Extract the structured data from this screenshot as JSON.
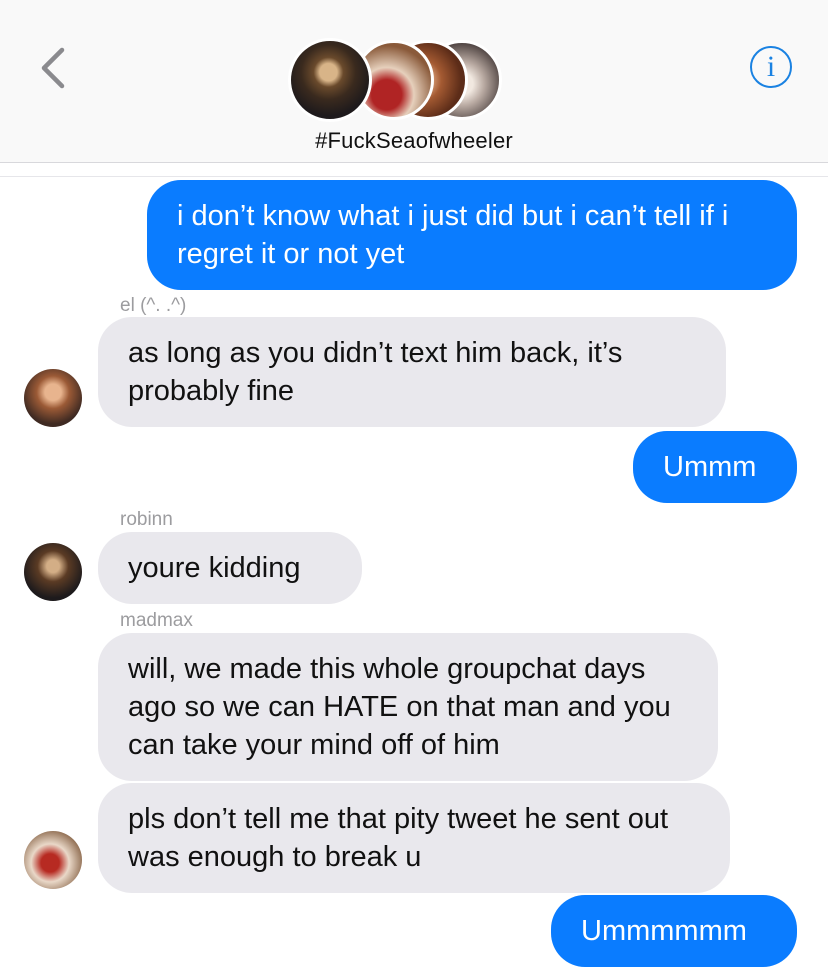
{
  "header": {
    "group_name": "#FuckSeaofwheeler",
    "info_glyph": "i",
    "back_icon": "chevron-left-icon"
  },
  "messages": [
    {
      "direction": "outgoing",
      "text": "i don’t know what i just did but i can’t tell if i regret it or not yet"
    },
    {
      "direction": "incoming",
      "sender": "el (^. .^)",
      "text": "as long as you didn’t text him back, it’s probably fine"
    },
    {
      "direction": "outgoing",
      "text": "Ummm"
    },
    {
      "direction": "incoming",
      "sender": "robinn",
      "text": "youre kidding"
    },
    {
      "direction": "incoming",
      "sender": "madmax",
      "text": "will, we made this whole groupchat days ago so we can HATE on that man and you can take your mind off of him"
    },
    {
      "direction": "incoming",
      "sender": "",
      "text": "pls don’t tell me that pity tweet he sent out was enough to break u"
    },
    {
      "direction": "outgoing",
      "text": "Ummmmmm"
    }
  ],
  "colors": {
    "outgoing_bubble": "#0a7cff",
    "incoming_bubble": "#e9e8ed",
    "accent": "#1a82e2"
  }
}
